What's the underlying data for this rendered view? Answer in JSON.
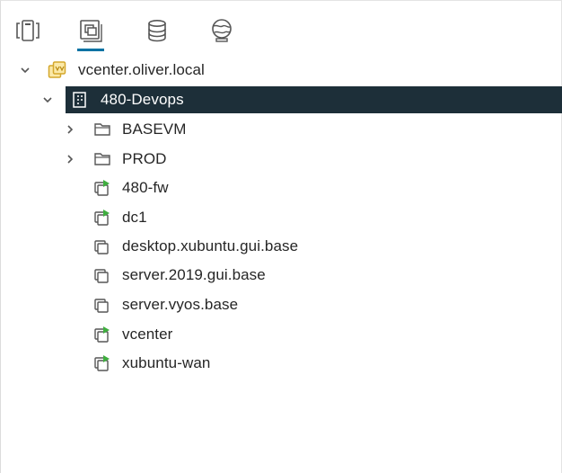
{
  "toolbar": {
    "tabs": [
      {
        "icon": "hosts-and-clusters-icon"
      },
      {
        "icon": "vms-and-templates-icon",
        "active": true
      },
      {
        "icon": "storage-icon"
      },
      {
        "icon": "networking-icon"
      }
    ],
    "accent_color": "#0072a3"
  },
  "tree": {
    "root": {
      "label": "vcenter.oliver.local",
      "icon": "vcenter-server-icon",
      "expanded": true
    },
    "datacenter": {
      "label": "480-Devops",
      "icon": "datacenter-icon",
      "expanded": true,
      "selected": true
    },
    "folders": [
      {
        "label": "BASEVM",
        "icon": "folder-icon",
        "expanded": false
      },
      {
        "label": "PROD",
        "icon": "folder-icon",
        "expanded": false
      }
    ],
    "vms": [
      {
        "label": "480-fw",
        "icon": "vm-powered-on-icon",
        "powered_on": true
      },
      {
        "label": "dc1",
        "icon": "vm-powered-on-icon",
        "powered_on": true
      },
      {
        "label": "desktop.xubuntu.gui.base",
        "icon": "vm-icon",
        "powered_on": false
      },
      {
        "label": "server.2019.gui.base",
        "icon": "vm-icon",
        "powered_on": false
      },
      {
        "label": "server.vyos.base",
        "icon": "vm-icon",
        "powered_on": false
      },
      {
        "label": "vcenter",
        "icon": "vm-powered-on-icon",
        "powered_on": true
      },
      {
        "label": "xubuntu-wan",
        "icon": "vm-powered-on-icon",
        "powered_on": true
      }
    ],
    "selected_bg_color": "#1d2f39",
    "power_on_color": "#3fae3f"
  }
}
